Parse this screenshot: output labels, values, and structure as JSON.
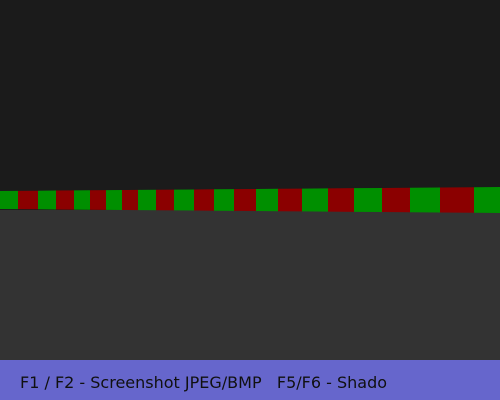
{
  "scene": {
    "sky_color": "#1b1b1b",
    "floor_color": "#333333",
    "tile_colors": [
      "#008f00",
      "#8b0000"
    ]
  },
  "hud": {
    "background": "#6666cc",
    "text": "F1 / F2 - Screenshot JPEG/BMP   F5/F6 - Shado"
  }
}
